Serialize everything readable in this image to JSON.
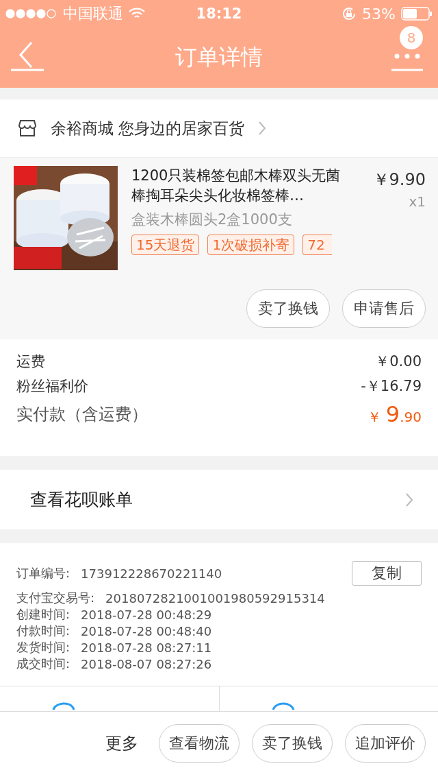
{
  "status_bar": {
    "carrier": "中国联通",
    "time": "18:12",
    "battery_percent": "53%"
  },
  "nav": {
    "title": "订单详情",
    "badge": "8"
  },
  "store": {
    "name": "余裕商城 您身边的居家百货"
  },
  "product": {
    "image": {
      "kind": "picture"
    },
    "title": "1200只装棉签包邮木棒双头无菌棒掏耳朵尖头化妆棉签棒…",
    "price": "￥9.90",
    "quantity": "x1",
    "sku": "盒装木棒圆头2盒1000支",
    "tags": [
      {
        "label": "15天退货",
        "cut": false
      },
      {
        "label": "1次破损补寄",
        "cut": false
      },
      {
        "label": "72",
        "cut": true
      }
    ],
    "buttons": [
      "卖了换钱",
      "申请售后"
    ]
  },
  "summary": {
    "rows": [
      {
        "label": "运费",
        "value": "￥0.00"
      },
      {
        "label": "粉丝福利价",
        "value": "-￥16.79"
      }
    ],
    "total": {
      "label": "实付款（含运费）",
      "currency": "￥",
      "integer": "9",
      "decimal": ".90"
    }
  },
  "bill_link": {
    "label": "查看花呗账单"
  },
  "order_info": {
    "copy_button": "复制",
    "rows": [
      {
        "label": "订单编号:",
        "value": "173912228670221140"
      },
      {
        "label": "支付宝交易号:",
        "value": "2018072821001001980592915314"
      },
      {
        "label": "创建时间:",
        "value": "2018-07-28 00:48:29"
      },
      {
        "label": "付款时间:",
        "value": "2018-07-28 00:48:40"
      },
      {
        "label": "发货时间:",
        "value": "2018-07-28 08:27:11"
      },
      {
        "label": "成交时间:",
        "value": "2018-08-07 08:27:26"
      }
    ]
  },
  "bottom_bar": {
    "more": "更多",
    "buttons": [
      "查看物流",
      "卖了换钱",
      "追加评价"
    ]
  }
}
